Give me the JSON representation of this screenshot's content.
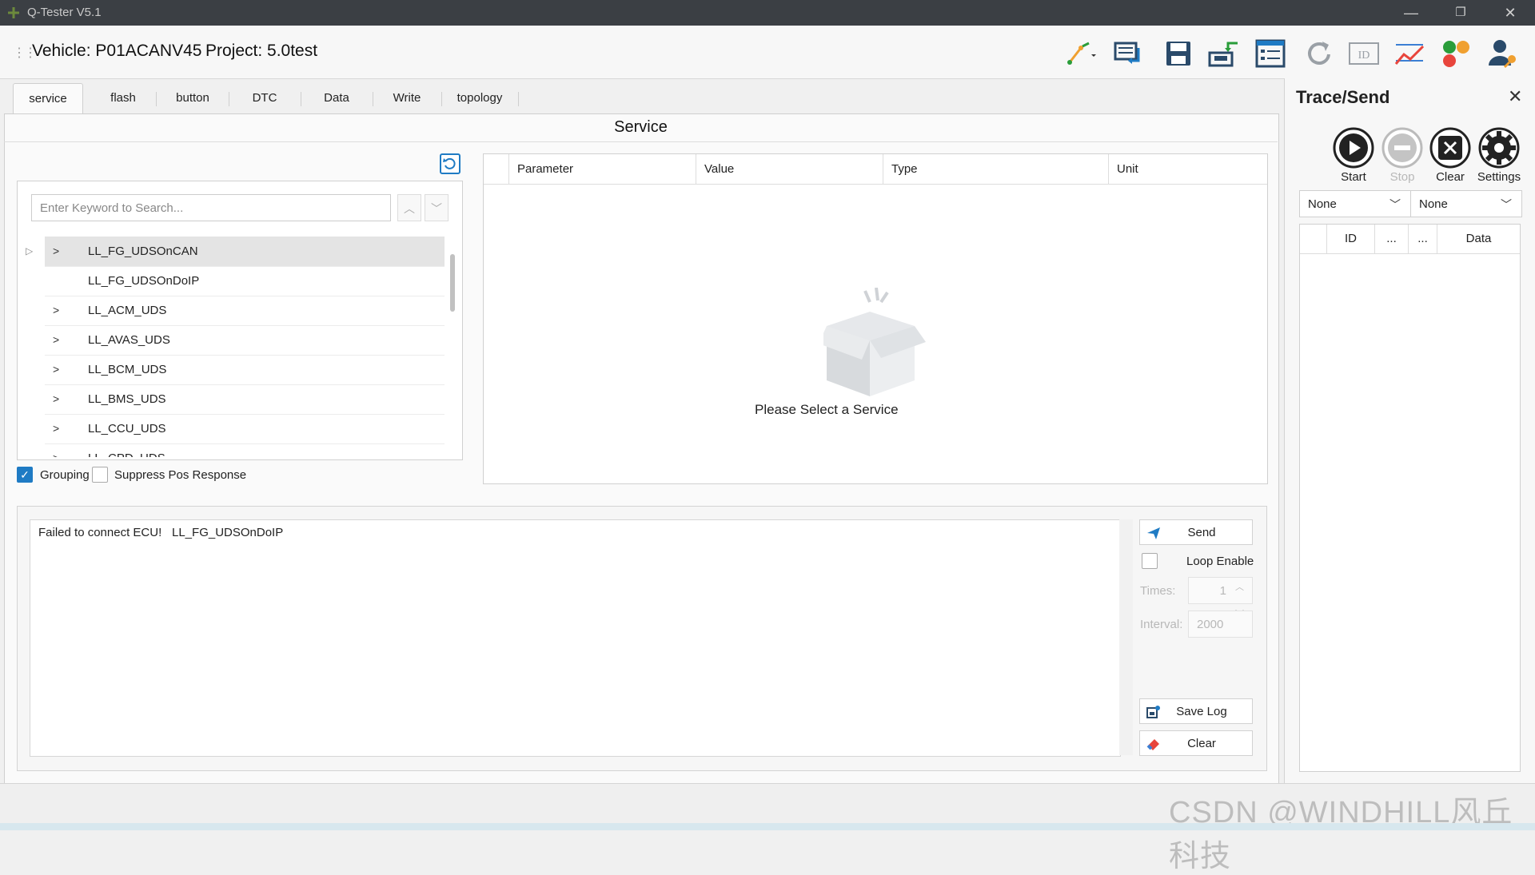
{
  "window": {
    "title": "Q-Tester V5.1",
    "minimize": "—",
    "restore": "❐",
    "close": "✕"
  },
  "header": {
    "vehicle": "Vehicle: P01ACANV45",
    "project": "Project: 5.0test",
    "tools": [
      "connect-icon",
      "monitor-transfer-icon",
      "save-icon",
      "import-icon",
      "list-icon",
      "refresh-icon",
      "id-icon",
      "graph-icon",
      "color-palette-icon",
      "user-key-icon"
    ]
  },
  "tabs": [
    "service",
    "flash",
    "button",
    "DTC",
    "Data",
    "Write",
    "topology"
  ],
  "service": {
    "title": "Service",
    "search_placeholder": "Enter Keyword to Search...",
    "tree": [
      {
        "label": "LL_FG_UDSOnCAN",
        "chevron": true,
        "selected": true
      },
      {
        "label": "LL_FG_UDSOnDoIP",
        "chevron": false,
        "selected": false
      },
      {
        "label": "LL_ACM_UDS",
        "chevron": true,
        "selected": false
      },
      {
        "label": "LL_AVAS_UDS",
        "chevron": true,
        "selected": false
      },
      {
        "label": "LL_BCM_UDS",
        "chevron": true,
        "selected": false
      },
      {
        "label": "LL_BMS_UDS",
        "chevron": true,
        "selected": false
      },
      {
        "label": "LL_CCU_UDS",
        "chevron": true,
        "selected": false
      },
      {
        "label": "LL_CPD_UDS",
        "chevron": true,
        "selected": false
      }
    ],
    "grouping_label": "Grouping",
    "grouping_checked": true,
    "suppress_label": "Suppress Pos Response",
    "suppress_checked": false
  },
  "params": {
    "columns": [
      "Parameter",
      "Value",
      "Type",
      "Unit"
    ],
    "empty_text": "Please Select a Service"
  },
  "log": {
    "message": "Failed to connect ECU!",
    "service": "LL_FG_UDSOnDoIP",
    "send_label": "Send",
    "loop_label": "Loop Enable",
    "times_label": "Times:",
    "times_value": "1",
    "interval_label": "Interval:",
    "interval_value": "2000",
    "save_log_label": "Save Log",
    "clear_label": "Clear"
  },
  "trace": {
    "title": "Trace/Send",
    "close": "✕",
    "start_label": "Start",
    "stop_label": "Stop",
    "clear_label": "Clear",
    "settings_label": "Settings",
    "combo1": "None",
    "combo2": "None",
    "columns": [
      "ID",
      "...",
      "...",
      "Data"
    ]
  },
  "watermark": "CSDN @WINDHILL风丘科技",
  "colors": {
    "accent": "#1f7bc4",
    "titlebar": "#3b3f44"
  }
}
